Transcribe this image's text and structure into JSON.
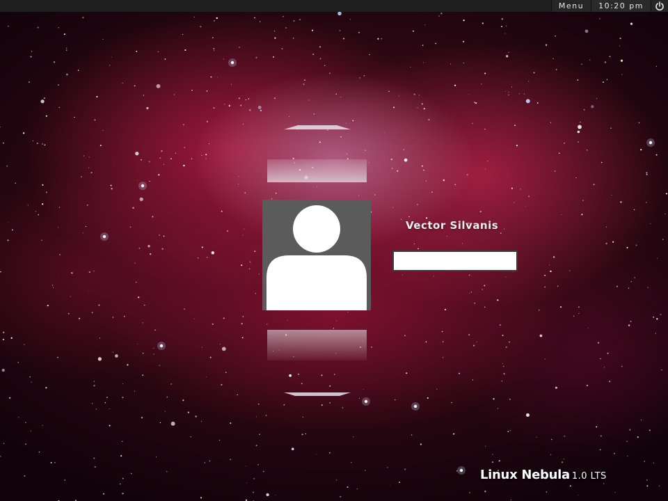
{
  "panel": {
    "menu_label": "Menu",
    "clock": "10:20 pm",
    "power_icon": "power-icon"
  },
  "greeter": {
    "user_name": "Vector Silvanis",
    "avatar_icon": "user-silhouette-icon",
    "password_value": "",
    "prev_user_icon": "chevron-up-icon",
    "next_user_icon": "chevron-down-icon"
  },
  "branding": {
    "distro_name": "Linux Nebula",
    "version": "1.0 LTS"
  },
  "colors": {
    "panel_background": "#1e1e1e",
    "avatar_background": "#5b5b5b",
    "nebula_red": "#b8204f",
    "text": "#ffffff"
  }
}
